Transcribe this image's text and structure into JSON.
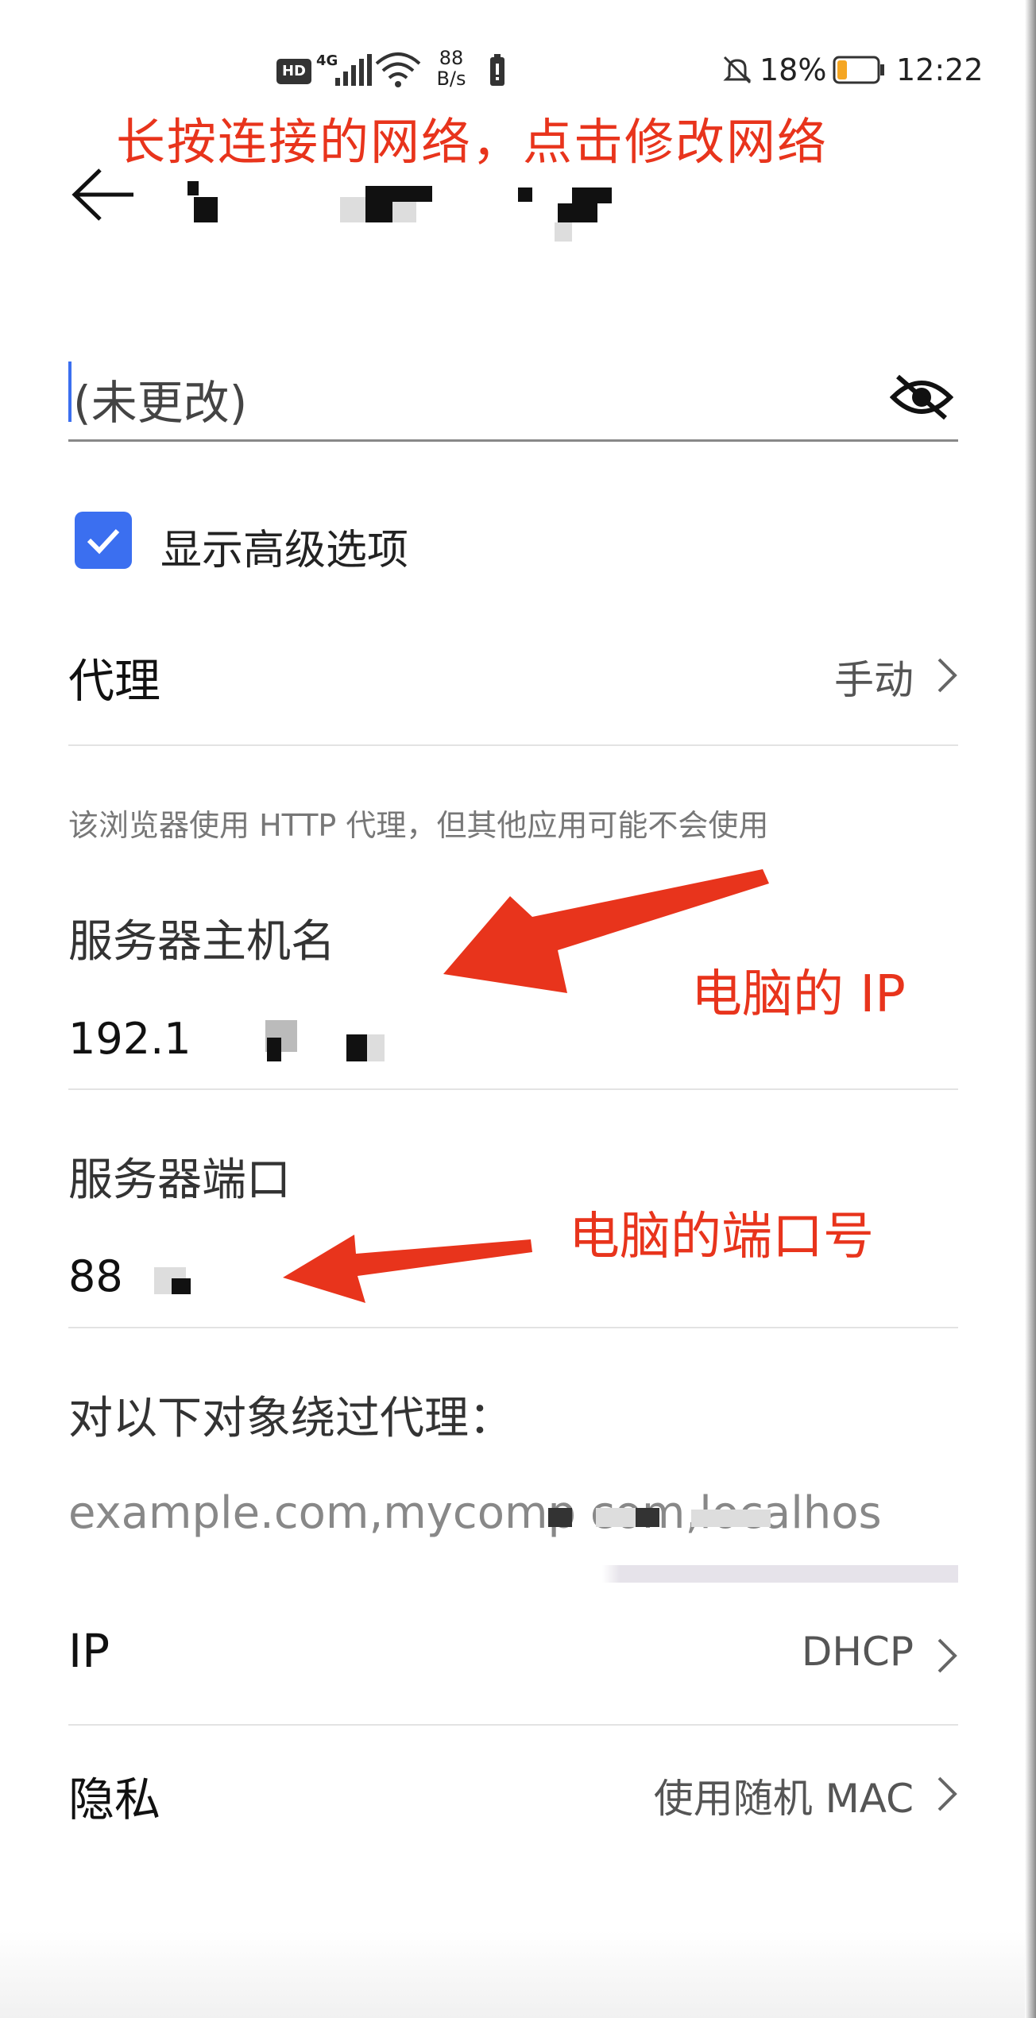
{
  "status_bar": {
    "hd": "HD",
    "network": "4G",
    "speed_value": "88",
    "speed_unit": "B/s",
    "battery_pct": "18%",
    "time": "12:22"
  },
  "annotations": {
    "title": "长按连接的网络，点击修改网络",
    "ip_note": "电脑的 IP",
    "port_note": "电脑的端口号"
  },
  "header": {
    "network_name": ""
  },
  "password": {
    "value": "(未更改)"
  },
  "advanced": {
    "label": "显示高级选项",
    "checked": true
  },
  "proxy": {
    "label": "代理",
    "value": "手动"
  },
  "proxy_note": "该浏览器使用 HTTP 代理，但其他应用可能不会使用",
  "host": {
    "label": "服务器主机名",
    "value": "192.1"
  },
  "port": {
    "label": "服务器端口",
    "value": "88"
  },
  "bypass": {
    "label": "对以下对象绕过代理：",
    "placeholder": "example.com,mycomp     com,localhos"
  },
  "ip": {
    "label": "IP",
    "value": "DHCP"
  },
  "privacy": {
    "label": "隐私",
    "value": "使用随机 MAC"
  },
  "colors": {
    "accent": "#3b6ff0",
    "annotation": "#e8341c"
  }
}
